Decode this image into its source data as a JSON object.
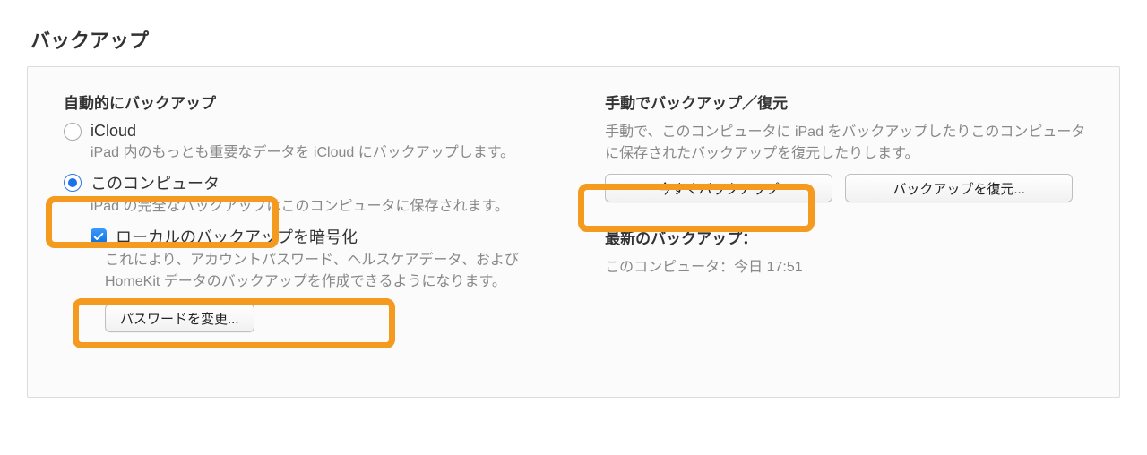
{
  "section_title": "バックアップ",
  "left": {
    "heading": "自動的にバックアップ",
    "icloud": {
      "label": "iCloud",
      "selected": false,
      "description": "iPad 内のもっとも重要なデータを iCloud にバックアップします。"
    },
    "this_computer": {
      "label": "このコンピュータ",
      "selected": true,
      "description": "iPad の完全なバックアップはこのコンピュータに保存されます。"
    },
    "encrypt": {
      "label": "ローカルのバックアップを暗号化",
      "checked": true,
      "description": "これにより、アカウントパスワード、ヘルスケアデータ、および HomeKit データのバックアップを作成できるようになります。"
    },
    "change_password_button": "パスワードを変更..."
  },
  "right": {
    "heading": "手動でバックアップ／復元",
    "description": "手動で、このコンピュータに iPad をバックアップしたりこのコンピュータに保存されたバックアップを復元したりします。",
    "backup_now_button": "今すぐバックアップ",
    "restore_backup_button": "バックアップを復元...",
    "latest_heading": "最新のバックアップ：",
    "latest_value": "このコンピュータ：今日 17:51"
  }
}
